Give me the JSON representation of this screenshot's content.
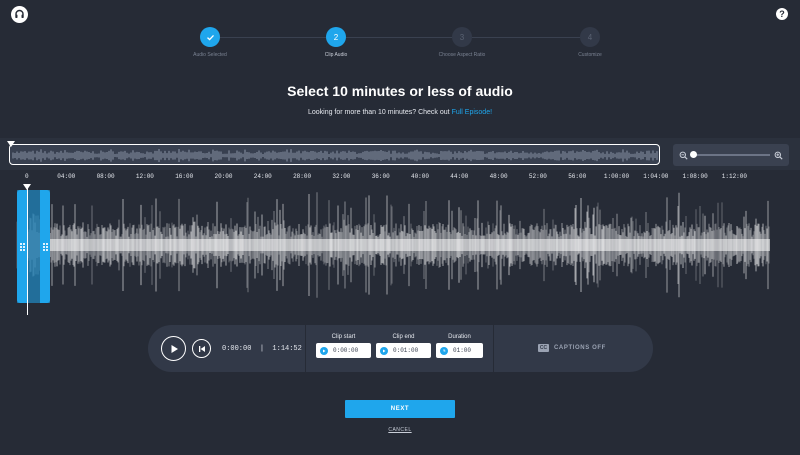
{
  "header": {
    "help_label": "?"
  },
  "stepper": {
    "steps": [
      {
        "number": "1",
        "label": "Audio Selected",
        "state": "complete"
      },
      {
        "number": "2",
        "label": "Clip Audio",
        "state": "current"
      },
      {
        "number": "3",
        "label": "Choose Aspect Ratio",
        "state": "upcoming"
      },
      {
        "number": "4",
        "label": "Customize",
        "state": "upcoming"
      }
    ]
  },
  "headline": {
    "title": "Select 10 minutes or less of audio",
    "subtitle_prefix": "Looking for more than 10 minutes? Check out ",
    "subtitle_link": "Full Episode!"
  },
  "timeline": {
    "ticks": [
      "0",
      "04:00",
      "08:00",
      "12:00",
      "16:00",
      "20:00",
      "24:00",
      "28:00",
      "32:00",
      "36:00",
      "40:00",
      "44:00",
      "48:00",
      "52:00",
      "56:00",
      "1:00:00",
      "1:04:00",
      "1:08:00",
      "1:12:00"
    ],
    "zoom_level": 0
  },
  "player": {
    "current_time": "0:00:00",
    "separator": "|",
    "total_time": "1:14:52"
  },
  "clip": {
    "start_label": "Clip start",
    "start_value": "0:00:00",
    "end_label": "Clip end",
    "end_value": "0:01:00",
    "duration_label": "Duration",
    "duration_value": "01:00"
  },
  "captions": {
    "icon_text": "CC",
    "label": "CAPTIONS OFF"
  },
  "footer": {
    "next_label": "NEXT",
    "cancel_label": "CANCEL"
  },
  "colors": {
    "background": "#262b36",
    "accent": "#1fa6ec",
    "panel": "#323948"
  },
  "icons": {
    "logo": "headphones-logo-icon",
    "help": "question-circle-icon",
    "check": "check-icon",
    "zoom_out": "zoom-out-icon",
    "zoom_in": "zoom-in-icon",
    "play": "play-icon",
    "skip_back": "skip-to-start-icon",
    "captions": "closed-captions-icon"
  }
}
